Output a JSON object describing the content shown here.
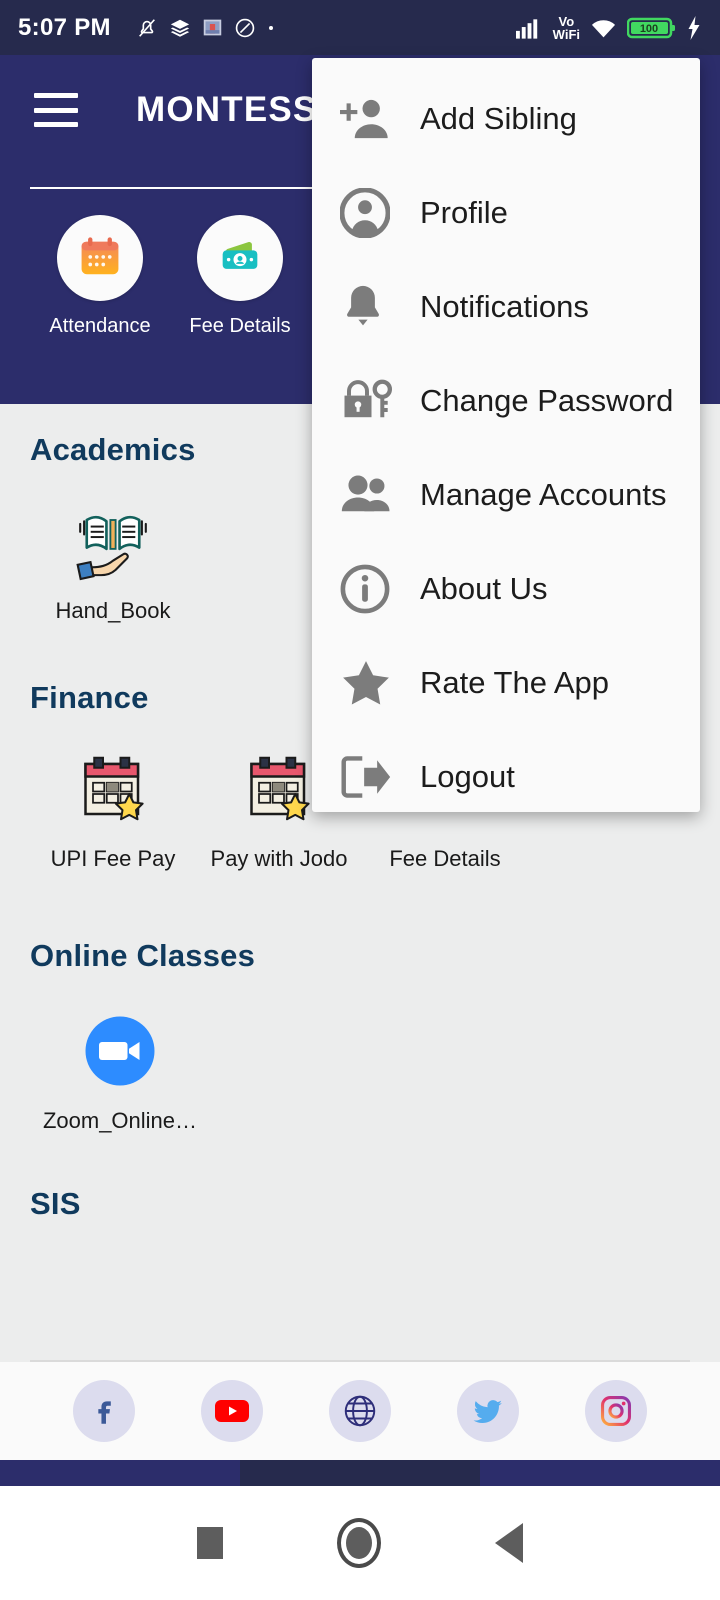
{
  "status_bar": {
    "time": "5:07 PM",
    "left_icons": [
      "bell-off-icon",
      "layers-icon",
      "photo-icon",
      "circle-slash-icon",
      "dot-icon"
    ],
    "right_icons": [
      "signal-bars-icon",
      "volte-wifi-icon",
      "wifi-icon",
      "battery-icon",
      "charging-bolt-icon"
    ],
    "volte_label_top": "Vo",
    "volte_label_bottom": "WiFi",
    "battery_level": "100"
  },
  "app_bar": {
    "menu_icon": "hamburger-icon",
    "title": "MONTESSORI",
    "quick_actions": [
      {
        "label": "Attendance",
        "icon": "calendar-icon"
      },
      {
        "label": "Fee Details",
        "icon": "wallet-money-icon"
      }
    ]
  },
  "sections": [
    {
      "title": "Academics",
      "items": [
        {
          "label": "Hand_Book",
          "icon": "book-on-hand-icon"
        }
      ]
    },
    {
      "title": "Finance",
      "items": [
        {
          "label": "UPI Fee Pay",
          "icon": "calendar-star-icon"
        },
        {
          "label": "Pay with Jodo",
          "icon": "calendar-star-icon"
        },
        {
          "label": "Fee Details",
          "icon": "wallet-money-icon"
        }
      ]
    },
    {
      "title": "Online Classes",
      "items": [
        {
          "label": "Zoom_Online…",
          "icon": "zoom-video-icon"
        }
      ]
    },
    {
      "title": "SIS",
      "items": []
    }
  ],
  "social": [
    {
      "name": "facebook-icon",
      "color": "#3b5998"
    },
    {
      "name": "youtube-icon",
      "color": "#ff0000"
    },
    {
      "name": "website-globe-icon",
      "color": "#2e2e7a"
    },
    {
      "name": "twitter-icon",
      "color": "#55acee"
    },
    {
      "name": "instagram-icon",
      "color": "#e1306c"
    }
  ],
  "overflow_menu": {
    "items": [
      {
        "label": "Add Sibling",
        "icon": "person-add-icon"
      },
      {
        "label": "Profile",
        "icon": "account-circle-icon"
      },
      {
        "label": "Notifications",
        "icon": "bell-icon"
      },
      {
        "label": "Change Password",
        "icon": "lock-key-icon"
      },
      {
        "label": "Manage Accounts",
        "icon": "people-icon"
      },
      {
        "label": "About Us",
        "icon": "info-circle-icon"
      },
      {
        "label": "Rate The App",
        "icon": "star-icon"
      },
      {
        "label": "Logout",
        "icon": "logout-icon"
      }
    ]
  },
  "android_nav": {
    "recents": "square-recents-icon",
    "home": "circle-home-icon",
    "back": "triangle-back-icon"
  },
  "colors": {
    "navy": "#2c2d6b",
    "status_navy": "#262a4d",
    "background": "#eceded",
    "section_heading": "#103a5d",
    "menu_bg": "#fafafa"
  }
}
